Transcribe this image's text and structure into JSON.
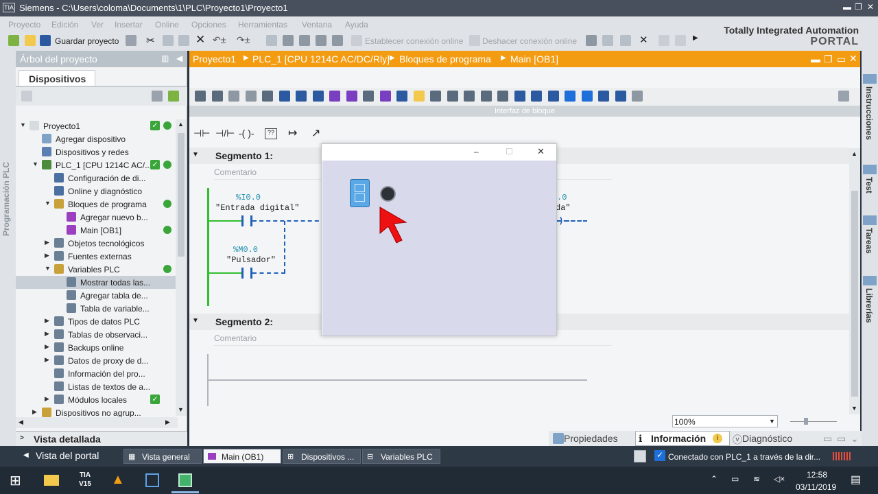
{
  "window": {
    "title": "Siemens  -  C:\\Users\\coloma\\Documents\\1\\PLC\\Proyecto1\\Proyecto1",
    "logo": "TIA"
  },
  "menu": [
    "Proyecto",
    "Edición",
    "Ver",
    "Insertar",
    "Online",
    "Opciones",
    "Herramientas",
    "Ventana",
    "Ayuda"
  ],
  "toolbar": {
    "save_label": "Guardar proyecto",
    "connect_label": "Establecer conexión online",
    "disconnect_label": "Deshacer conexión online"
  },
  "brand": {
    "line1": "Totally Integrated Automation",
    "line2": "PORTAL"
  },
  "left_vertical": "Programación PLC",
  "tree": {
    "header": "Árbol del proyecto",
    "tab": "Dispositivos",
    "items": [
      {
        "label": "Proyecto1",
        "level": 0,
        "tri": "▼",
        "status": "check-dot"
      },
      {
        "label": "Agregar dispositivo",
        "level": 1,
        "tri": ""
      },
      {
        "label": "Dispositivos y redes",
        "level": 1,
        "tri": ""
      },
      {
        "label": "PLC_1 [CPU 1214C AC/...",
        "level": 1,
        "tri": "▼",
        "status": "check-dot"
      },
      {
        "label": "Configuración de di...",
        "level": 2,
        "tri": ""
      },
      {
        "label": "Online y diagnóstico",
        "level": 2,
        "tri": ""
      },
      {
        "label": "Bloques de programa",
        "level": 2,
        "tri": "▼",
        "status": "dot"
      },
      {
        "label": "Agregar nuevo b...",
        "level": 3,
        "tri": ""
      },
      {
        "label": "Main [OB1]",
        "level": 3,
        "tri": "",
        "status": "dot"
      },
      {
        "label": "Objetos tecnológicos",
        "level": 2,
        "tri": "▶"
      },
      {
        "label": "Fuentes externas",
        "level": 2,
        "tri": "▶"
      },
      {
        "label": "Variables PLC",
        "level": 2,
        "tri": "▼",
        "status": "dot"
      },
      {
        "label": "Mostrar todas las...",
        "level": 3,
        "tri": "",
        "selected": true
      },
      {
        "label": "Agregar tabla de...",
        "level": 3,
        "tri": ""
      },
      {
        "label": "Tabla de variable...",
        "level": 3,
        "tri": ""
      },
      {
        "label": "Tipos de datos PLC",
        "level": 2,
        "tri": "▶"
      },
      {
        "label": "Tablas de observaci...",
        "level": 2,
        "tri": "▶"
      },
      {
        "label": "Backups online",
        "level": 2,
        "tri": "▶"
      },
      {
        "label": "Datos de proxy de d...",
        "level": 2,
        "tri": "▶"
      },
      {
        "label": "Información del pro...",
        "level": 2,
        "tri": ""
      },
      {
        "label": "Listas de textos de a...",
        "level": 2,
        "tri": ""
      },
      {
        "label": "Módulos locales",
        "level": 2,
        "tri": "▶",
        "status": "check"
      },
      {
        "label": "Dispositivos no agrup...",
        "level": 1,
        "tri": "▶"
      }
    ],
    "detail": "Vista detallada"
  },
  "editor": {
    "breadcrumb": [
      "Proyecto1",
      "PLC_1 [CPU 1214C AC/DC/Rly]",
      "Bloques de programa",
      "Main [OB1]"
    ],
    "block_interface": "Interfaz de bloque",
    "segment1": {
      "title": "Segmento 1:",
      "comment": "Comentario",
      "c1_addr": "%I0.0",
      "c1_name": "\"Entrada digital\"",
      "c2_addr": "%M0.0",
      "c2_name": "\"Pulsador\"",
      "coil_addr": ".0",
      "coil_name": "da\""
    },
    "segment2": {
      "title": "Segmento 2:",
      "comment": "Comentario"
    },
    "zoom": "100%"
  },
  "bottom_tabs": {
    "properties": "Propiedades",
    "info": "Información",
    "diagnostic": "Diagnóstico"
  },
  "right_tabs": [
    "Instrucciones",
    "Test",
    "Tareas",
    "Librerías"
  ],
  "status": {
    "portal": "Vista del portal",
    "tabs": [
      "Vista general",
      "Main (OB1)",
      "Dispositivos ...",
      "Variables PLC"
    ],
    "connected": "Conectado con PLC_1 a través de la dir..."
  },
  "taskbar": {
    "time": "12:58",
    "date": "03/11/2019",
    "tia_icon": "TIA\nV15"
  },
  "colors": {
    "accent": "#f39c12",
    "rung": "#2fbf2f",
    "tag_blue": "#1f8fb0"
  }
}
